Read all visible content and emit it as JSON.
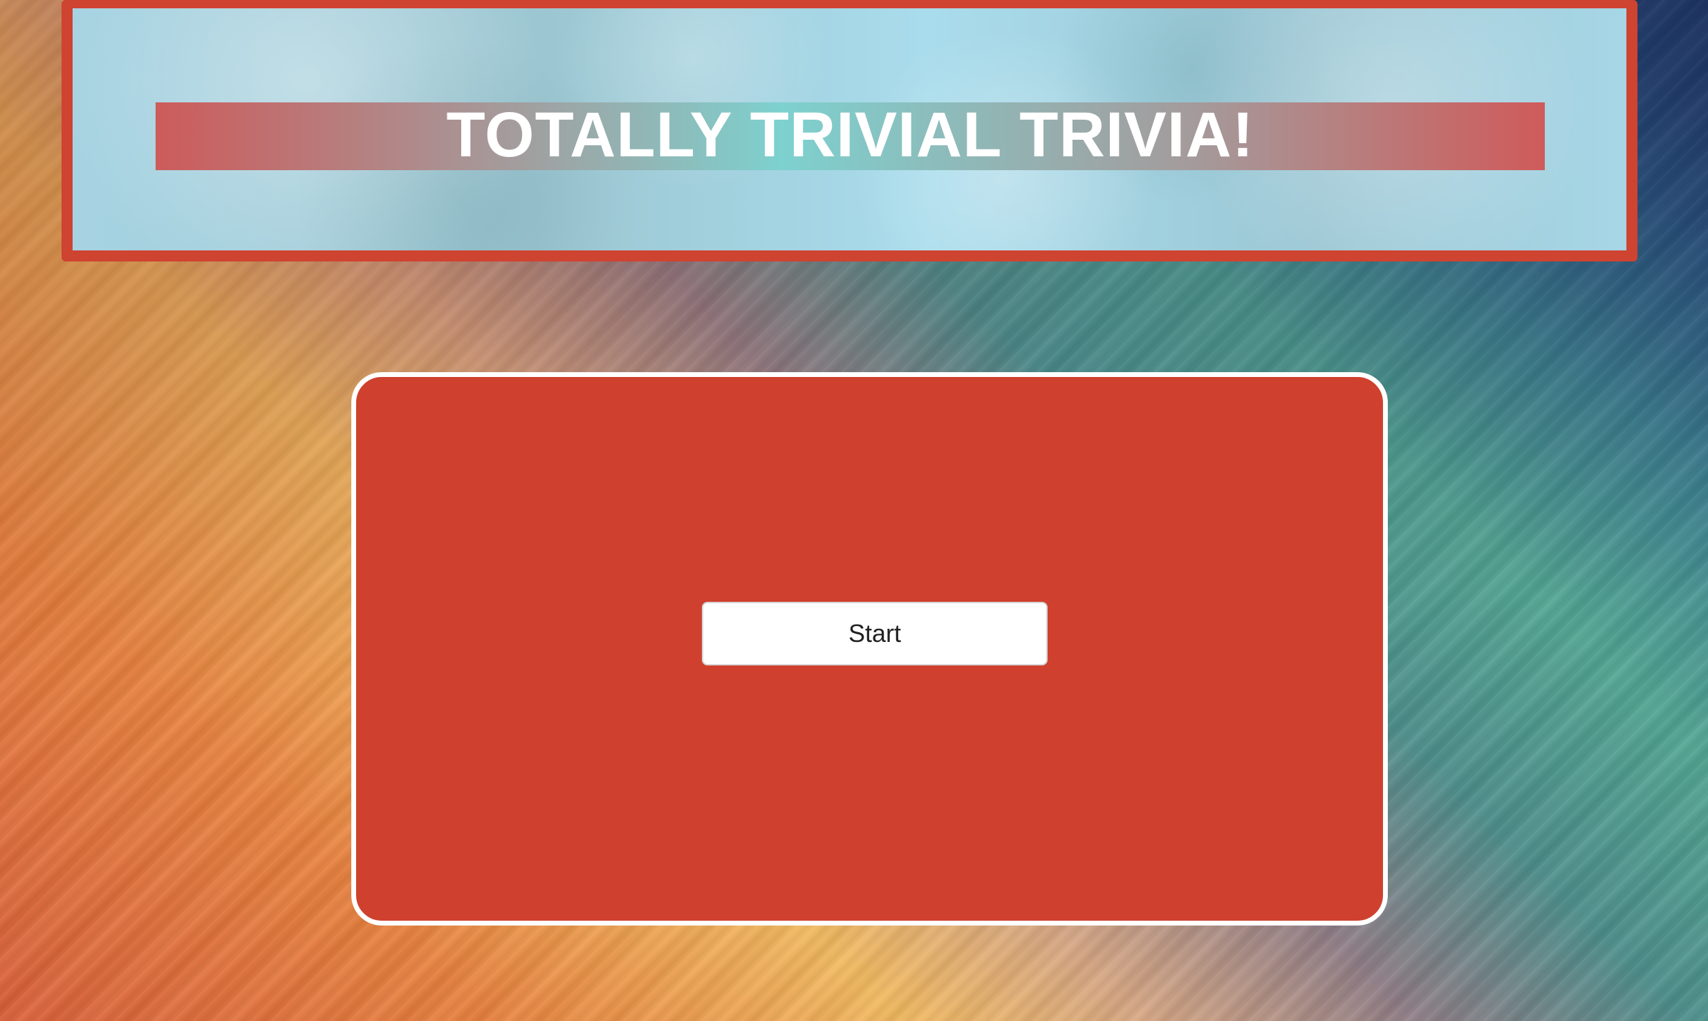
{
  "header": {
    "title": "TOTALLY TRIVIAL TRIVIA!"
  },
  "main": {
    "start_label": "Start"
  },
  "colors": {
    "accent_red": "#cf402e",
    "header_glass": "#a6d3e2",
    "title_text": "#ffffff",
    "button_bg": "#ffffff"
  }
}
